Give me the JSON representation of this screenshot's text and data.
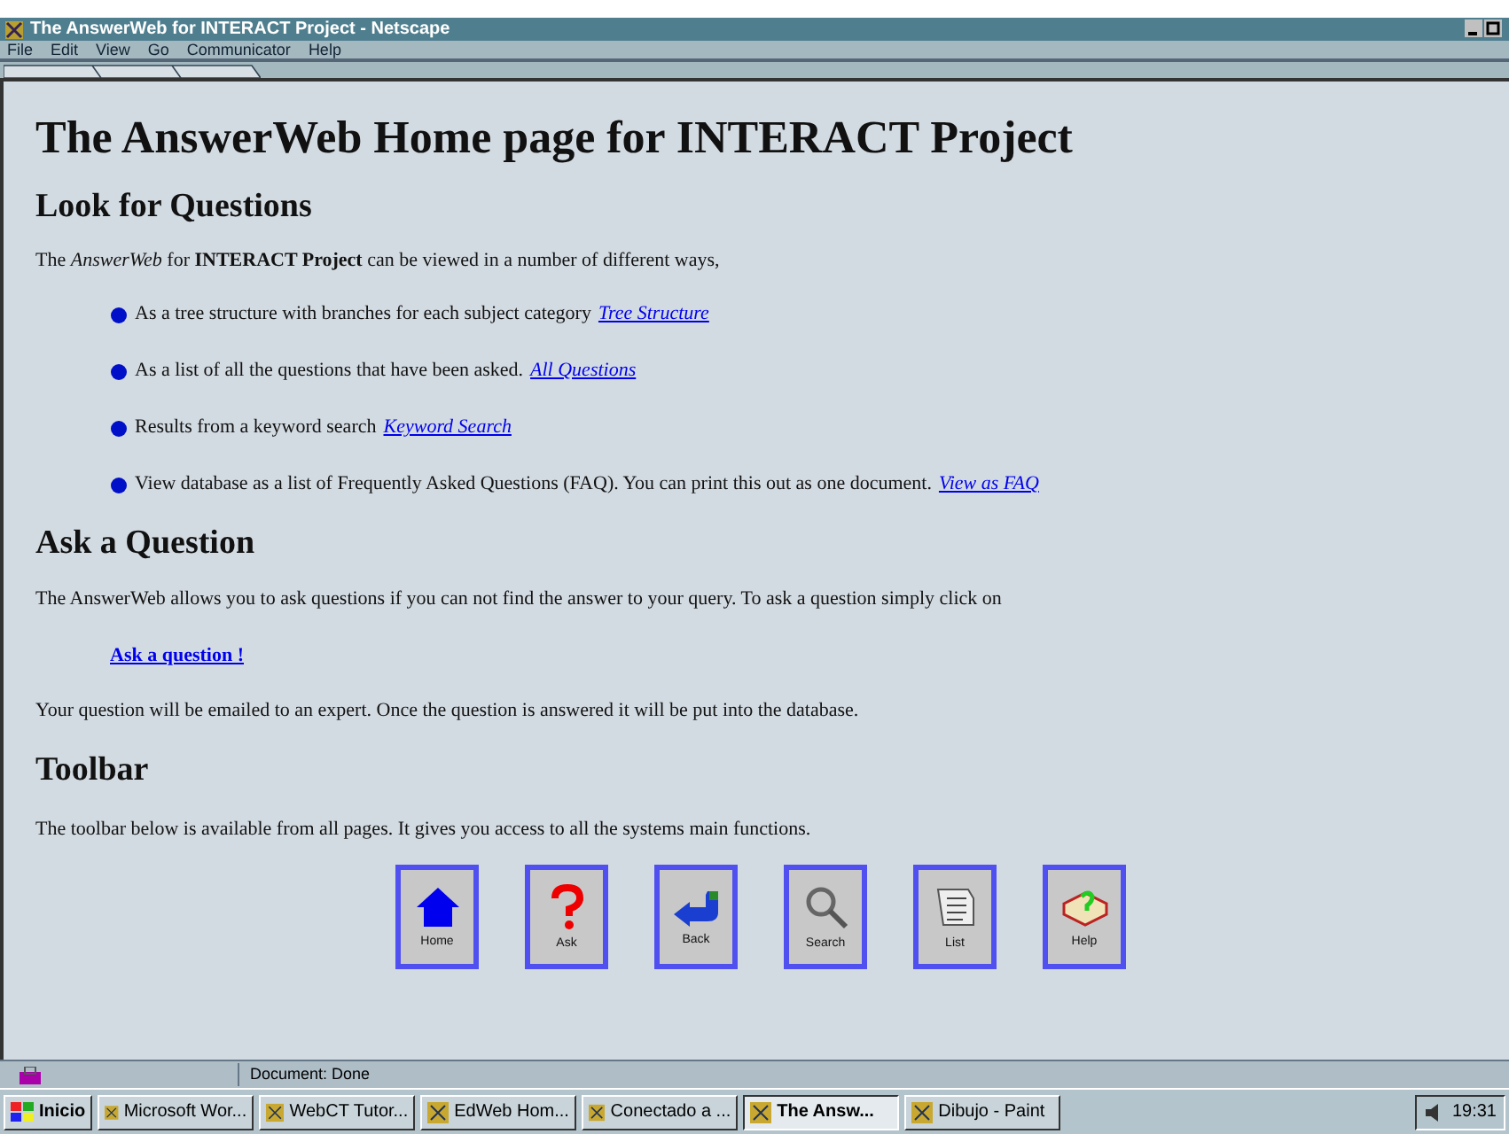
{
  "window": {
    "title": "The AnswerWeb for INTERACT Project - Netscape"
  },
  "menu": [
    "File",
    "Edit",
    "View",
    "Go",
    "Communicator",
    "Help"
  ],
  "page": {
    "title": "The AnswerWeb Home page for INTERACT Project",
    "sections": [
      {
        "heading": "Look for Questions",
        "intro": "The *AnswerWeb* for **INTERACT Project** can be viewed in a number of different ways,",
        "bullets": [
          {
            "text": "As a tree structure with branches for each subject category",
            "link": "Tree Structure"
          },
          {
            "text": "As a list of all the questions that have been asked.",
            "link": "All Questions"
          },
          {
            "text": "Results from a keyword search",
            "link": "Keyword Search"
          },
          {
            "text": "View database as a list of Frequently Asked Questions (FAQ). You can print this out as one document.",
            "link": "View as FAQ"
          }
        ]
      },
      {
        "heading": "Ask a Question",
        "intro": "The AnswerWeb allows you to ask questions if you can not find the answer to your query. To ask a question simply click on",
        "action_link": "Ask a question !",
        "outro": "Your question will be emailed to an expert. Once the question is answered it will be put into the database."
      },
      {
        "heading": "Toolbar",
        "intro": "The toolbar below is available from all pages. It gives you access to all the systems main functions.",
        "tools": [
          {
            "kind": "home",
            "label": "Home"
          },
          {
            "kind": "ask",
            "label": "Ask"
          },
          {
            "kind": "back",
            "label": "Back"
          },
          {
            "kind": "search",
            "label": "Search"
          },
          {
            "kind": "list",
            "label": "List"
          },
          {
            "kind": "help",
            "label": "Help"
          }
        ]
      }
    ]
  },
  "status_bar": {
    "text": "Document: Done"
  },
  "taskbar": {
    "start": "Inicio",
    "items": [
      {
        "label": "Microsoft Wor...",
        "selected": false
      },
      {
        "label": "WebCT Tutor...",
        "selected": false
      },
      {
        "label": "EdWeb Hom...",
        "selected": false
      },
      {
        "label": "Conectado a ...",
        "selected": false
      },
      {
        "label": "The Answ...",
        "selected": true
      },
      {
        "label": "Dibujo - Paint",
        "selected": false
      }
    ],
    "clock": "19:31"
  }
}
